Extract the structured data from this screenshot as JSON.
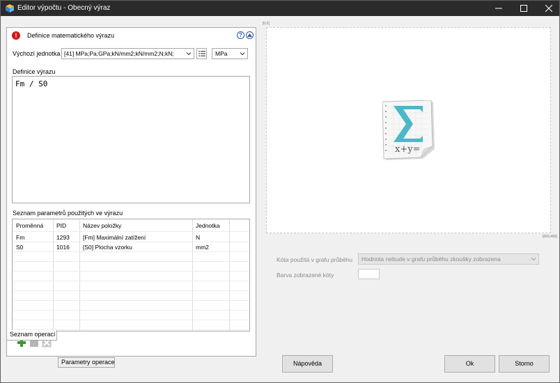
{
  "window": {
    "title": "Editor výpočtu - Obecný výraz"
  },
  "definition": {
    "title": "Definice matematického výrazu",
    "help_glyph": "?",
    "default_unit_label": "Výchozí jednotka",
    "unit_group_value": "[41] MPa;Pa;GPa;kN/mm2;kN/mm2;N;kN;",
    "unit_value": "MPa",
    "expression_label": "Definice výrazu",
    "expression": "Fm / S0"
  },
  "params": {
    "label": "Seznam parametrů použitých ve výrazu",
    "columns": [
      "Proměnná",
      "PID",
      "Název položky",
      "Jednotka"
    ],
    "rows": [
      [
        "Fm",
        "1293",
        "[Fm]  Maximální zatížení",
        "N"
      ],
      [
        "S0",
        "1016",
        "[S0]  Plocha vzorku",
        "mm2"
      ]
    ]
  },
  "tabs": [
    "Seznam operací",
    "Parametry operace"
  ],
  "preview": {
    "top_left_label": "[0,0]",
    "bottom_right_label": "[650,400]",
    "icon": "sigma-formula-icon",
    "icon_text": "x+y="
  },
  "graph": {
    "kota_label": "Kóta použitá v grafu průběhu",
    "kota_value": "Hodnota nebude v grafu průběhu zkoušky zobrazena",
    "color_label": "Barva zobrazené kóty"
  },
  "buttons": {
    "help": "Nápověda",
    "ok": "Ok",
    "cancel": "Storno"
  },
  "colors": {
    "titlebar": "#2b2b2b",
    "warning": "#d41616",
    "accent": "#2c5aa0",
    "sigma": "#4bb8c8"
  }
}
